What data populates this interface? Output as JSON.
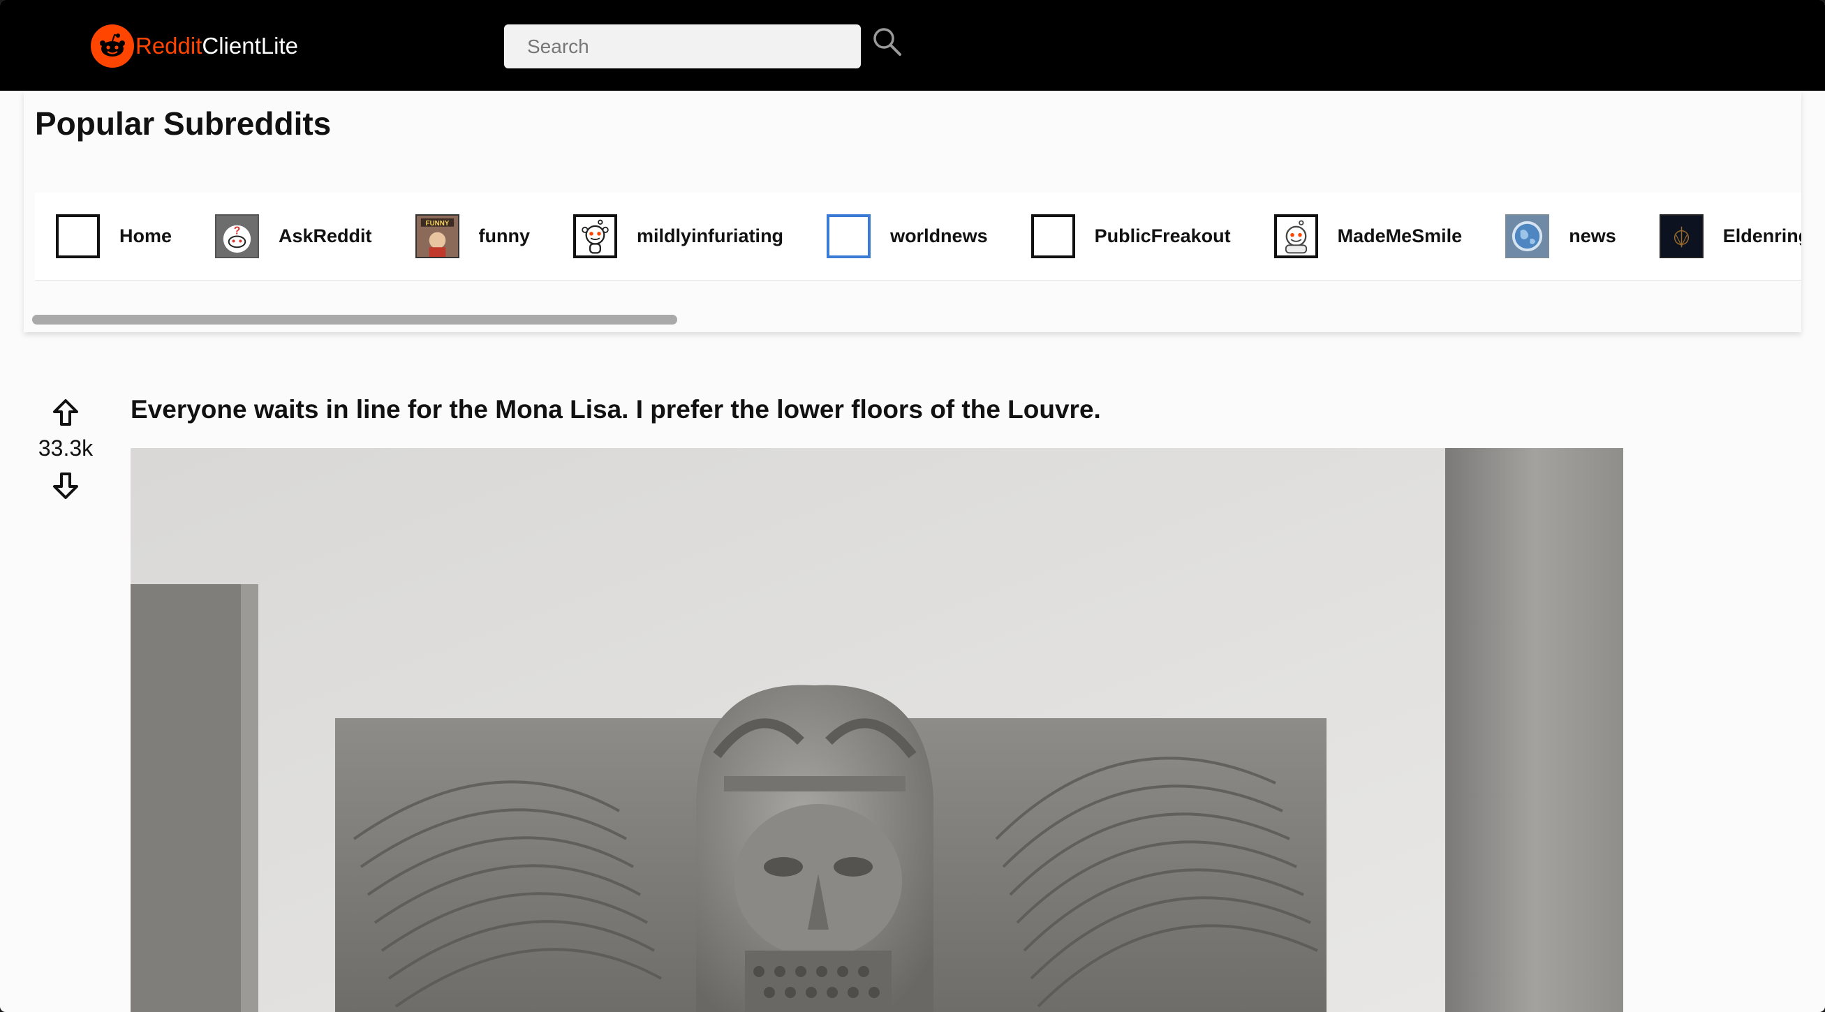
{
  "header": {
    "logo_part1": "Reddit",
    "logo_part2": "ClientLite",
    "search_placeholder": "Search"
  },
  "popular": {
    "title": "Popular Subreddits",
    "subreddits": [
      {
        "label": "Home",
        "icon": "blank-square-icon"
      },
      {
        "label": "AskReddit",
        "icon": "askreddit-snoo-icon"
      },
      {
        "label": "funny",
        "icon": "funny-icon"
      },
      {
        "label": "mildlyinfuriating",
        "icon": "snoo-icon"
      },
      {
        "label": "worldnews",
        "icon": "blank-square-icon"
      },
      {
        "label": "PublicFreakout",
        "icon": "blank-square-icon"
      },
      {
        "label": "MadeMeSmile",
        "icon": "snoo-icon"
      },
      {
        "label": "news",
        "icon": "globe-icon"
      },
      {
        "label": "Eldenring",
        "icon": "eldenring-icon"
      },
      {
        "label": "",
        "icon": "snoo-icon"
      }
    ],
    "scroll_fraction": 0.22
  },
  "post": {
    "score": "33.3k",
    "title": "Everyone waits in line for the Mona Lisa. I prefer the lower floors of the Louvre."
  },
  "colors": {
    "brand": "#ff4500",
    "header_bg": "#000000",
    "news_border": "#3a7bd5"
  }
}
